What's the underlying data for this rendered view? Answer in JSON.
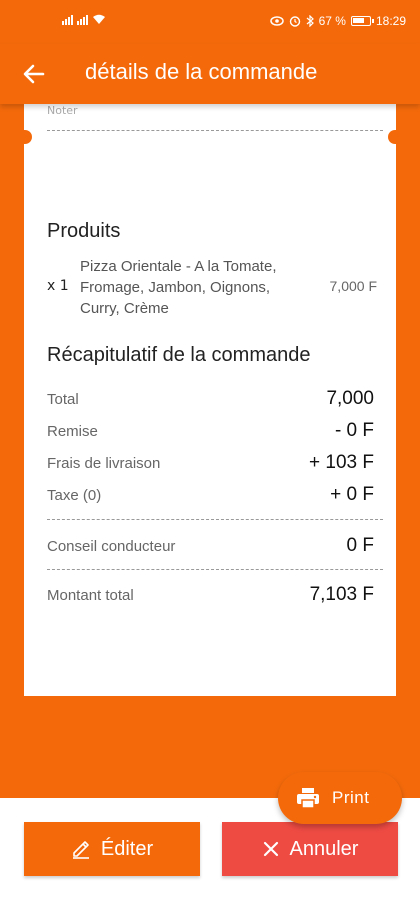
{
  "status_bar": {
    "battery": "67 %",
    "time": "18:29"
  },
  "app_bar": {
    "title": "détails de la commande"
  },
  "receipt": {
    "note_label": "Noter",
    "products_title": "Produits",
    "products": [
      {
        "qty": "x 1",
        "name": "Pizza Orientale - A la Tomate, Fromage, Jambon, Oignons, Curry, Crème",
        "price": "7,000 F"
      }
    ],
    "summary_title": "Récapitulatif de la commande",
    "summary": [
      {
        "label": "Total",
        "value": "7,000"
      },
      {
        "label": "Remise",
        "value": "- 0 F"
      },
      {
        "label": "Frais de livraison",
        "value": "+ 103 F"
      },
      {
        "label": "Taxe (0)",
        "value": "+ 0 F"
      }
    ],
    "tip": {
      "label": "Conseil conducteur",
      "value": "0 F"
    },
    "grand_total": {
      "label": "Montant total",
      "value": "7,103 F"
    }
  },
  "actions": {
    "print_label": "Print",
    "edit_label": "Éditer",
    "cancel_label": "Annuler"
  },
  "colors": {
    "primary": "#f46a0b",
    "cancel": "#ee4b43",
    "surface": "#ffffff"
  }
}
